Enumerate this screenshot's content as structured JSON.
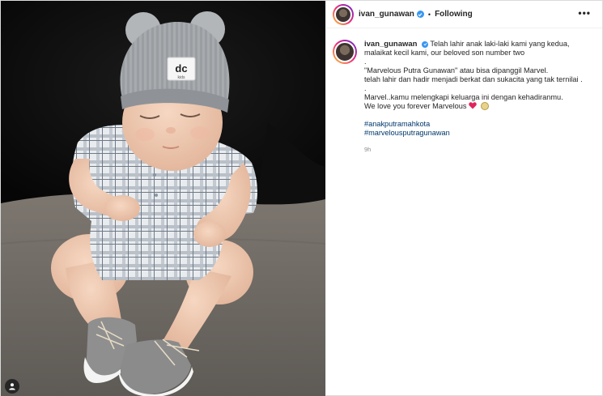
{
  "post": {
    "author": {
      "username": "ivan_gunawan",
      "verified": true,
      "follow_status": "Following"
    },
    "header_separator": "•",
    "more_label": "•••",
    "caption": {
      "lines": [
        "Telah lahir anak laki-laki kami yang kedua,",
        "malaikat kecil kami, our beloved son number two",
        "."
      ],
      "paragraph2": [
        "\"Marvelous Putra Gunawan\" atau bisa dipanggil Marvel.",
        "telah lahir dan hadir menjadi berkat dan sukacita yang tak ternilai ."
      ],
      "paragraph3_dot": ".",
      "paragraph3": [
        "Marvel..kamu melengkapi keluarga ini dengan kehadiranmu.",
        "We love you forever Marvelous"
      ],
      "emojis": [
        "red-heart",
        "smiling-face"
      ],
      "hashtags": [
        "#anakputramahkota",
        "#marvelousputragunawan"
      ]
    },
    "time_ago": "9h"
  },
  "media": {
    "subject": "baby-photo",
    "hat_logo_text": "dc",
    "hat_logo_subtext": "kids",
    "has_user_tags": true
  },
  "colors": {
    "link": "#00376b",
    "verified_badge": "#3897f0",
    "meta_text": "#8e8e8e",
    "heart": "#e0245e"
  }
}
